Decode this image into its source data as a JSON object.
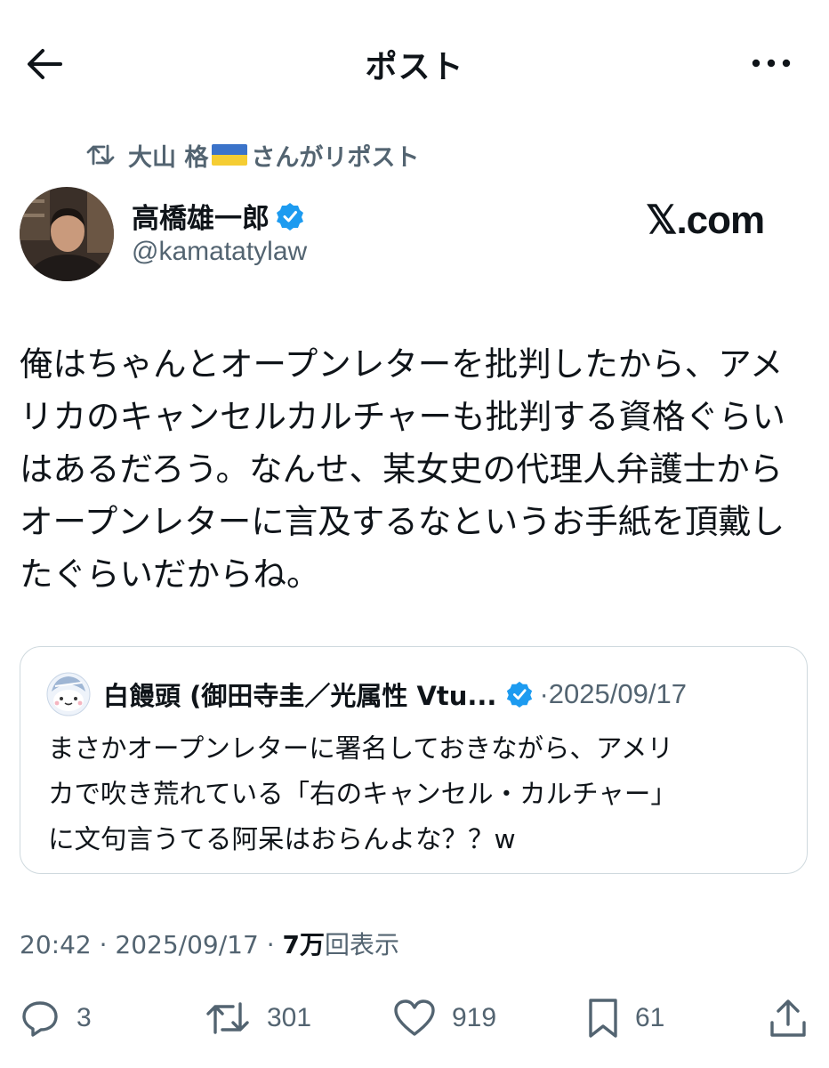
{
  "header": {
    "title": "ポスト"
  },
  "repost": {
    "name": "大山 格",
    "suffix": "さんがリポスト"
  },
  "author": {
    "name": "高橋雄一郎",
    "handle": "@kamatatylaw",
    "verified": true
  },
  "watermark": "𝕏.com",
  "post": {
    "text": "俺はちゃんとオープンレターを批判したから、アメ\nリカのキャンセルカルチャーも批判する資格ぐらい\nはあるだろう。なんせ、某女史の代理人弁護士から\nオープンレターに言及するなというお手紙を頂戴し\nたぐらいだからね。"
  },
  "quote": {
    "name": "白饅頭 (御田寺圭／光属性 Vtu...",
    "date": "2025/09/17",
    "text": "まさかオープンレターに署名しておきながら、アメリ\nカで吹き荒れている「右のキャンセル・カルチャー」\nに文句言うてる阿呆はおらんよな？？w"
  },
  "meta": {
    "time": "20:42",
    "date": "2025/09/17",
    "views_count": "7万",
    "views_label": "回表示"
  },
  "actions": {
    "replies": "3",
    "reposts": "301",
    "likes": "919",
    "bookmarks": "61"
  },
  "colors": {
    "accent": "#1d9bf0",
    "secondary": "#536471",
    "text": "#0f1419",
    "border": "#cfd9de"
  },
  "icons": [
    "back-arrow-icon",
    "more-icon",
    "repost-icon",
    "verified-badge-icon",
    "reply-icon",
    "retweet-icon",
    "heart-icon",
    "bookmark-icon",
    "share-icon"
  ]
}
